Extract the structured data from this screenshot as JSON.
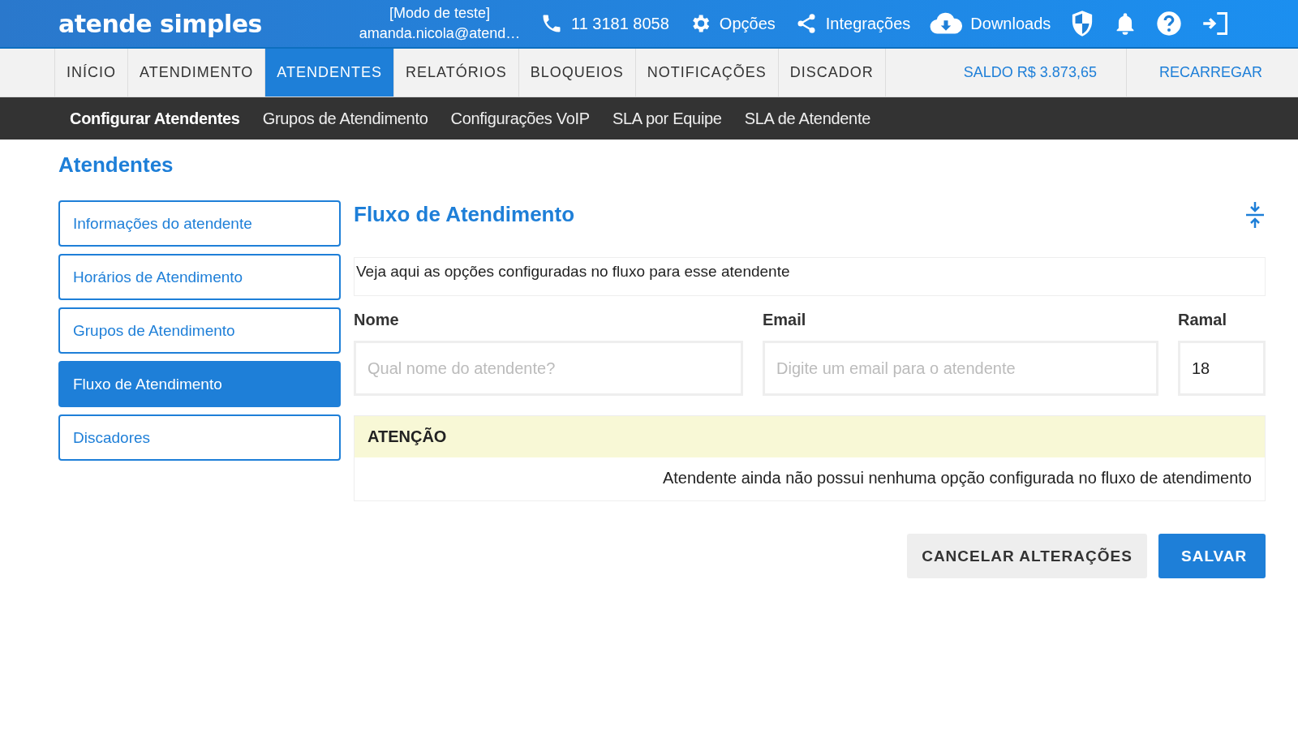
{
  "header": {
    "logo": "atende simples",
    "mode": "[Modo de teste]",
    "user": "amanda.nicola@atend…",
    "links": [
      {
        "kind": "phone",
        "label": "11 3181 8058"
      },
      {
        "kind": "gear",
        "label": "Opções"
      },
      {
        "kind": "share",
        "label": "Integrações"
      },
      {
        "kind": "download",
        "label": "Downloads"
      },
      {
        "kind": "shield"
      },
      {
        "kind": "bell"
      },
      {
        "kind": "help"
      },
      {
        "kind": "logout"
      }
    ]
  },
  "tabs": [
    {
      "label": "INÍCIO",
      "selected": false
    },
    {
      "label": "ATENDIMENTO",
      "selected": false
    },
    {
      "label": "ATENDENTES",
      "selected": true
    },
    {
      "label": "RELATÓRIOS",
      "selected": false
    },
    {
      "label": "BLOQUEIOS",
      "selected": false
    },
    {
      "label": "NOTIFICAÇÕES",
      "selected": false
    },
    {
      "label": "DISCADOR",
      "selected": false
    }
  ],
  "balance": "SALDO R$ 3.873,65",
  "recharge": "RECARREGAR",
  "subtabs": [
    {
      "label": "Configurar Atendentes",
      "selected": true
    },
    {
      "label": "Grupos de Atendimento",
      "selected": false
    },
    {
      "label": "Configurações VoIP",
      "selected": false
    },
    {
      "label": "SLA por Equipe",
      "selected": false
    },
    {
      "label": "SLA de Atendente",
      "selected": false
    }
  ],
  "page_title": "Atendentes",
  "sidebar": {
    "items": [
      {
        "label": "Informações do atendente",
        "selected": false
      },
      {
        "label": "Horários de Atendimento",
        "selected": false
      },
      {
        "label": "Grupos de Atendimento",
        "selected": false
      },
      {
        "label": "Fluxo de Atendimento",
        "selected": true
      },
      {
        "label": "Discadores",
        "selected": false
      }
    ]
  },
  "panel": {
    "title": "Fluxo de Atendimento",
    "description": "Veja aqui as opções configuradas no fluxo para esse atendente",
    "fields": [
      {
        "label": "Nome",
        "placeholder": "Qual nome do atendente?"
      },
      {
        "label": "Email",
        "placeholder": "Digite um email para o atendente"
      },
      {
        "label": "Ramal",
        "value": "18"
      }
    ],
    "alert": {
      "title": "ATENÇÃO",
      "message": "Atendente ainda não possui nenhuma opção configurada no fluxo de atendimento"
    },
    "buttons": [
      {
        "kind": "secondary",
        "label": "CANCELAR ALTERAÇÕES"
      },
      {
        "kind": "primary",
        "label": "SALVAR"
      }
    ]
  }
}
